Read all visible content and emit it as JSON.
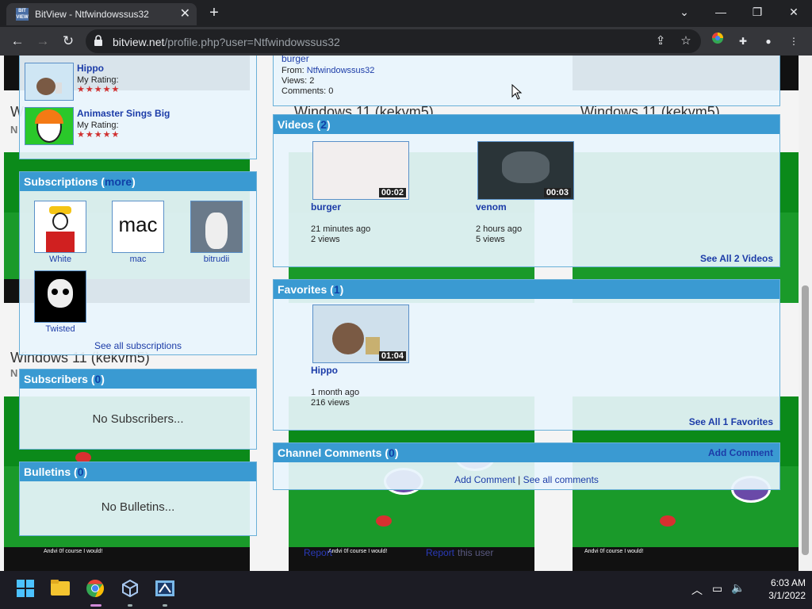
{
  "browser": {
    "tab_title": "BitView - Ntfwindowssus32",
    "favicon_text": "BIT VIEW",
    "tab_close": "✕",
    "new_tab": "+",
    "url_host": "bitview.net",
    "url_path": "/profile.php?user=Ntfwindowssus32"
  },
  "background": {
    "caption": "Windows 11 (kekvm5)",
    "small_text": "N",
    "gibberish": "Andvi 0f course I would!",
    "report": "Report",
    "this_user": "this user"
  },
  "favorites_sidebar": {
    "items": [
      {
        "title": "Hippo",
        "rating_label": "My Rating:",
        "stars": "★★★★★"
      },
      {
        "title": "Animaster Sings Big",
        "rating_label": "My Rating:",
        "stars": "★★★★★"
      }
    ]
  },
  "subscriptions": {
    "title": "Subscriptions",
    "open_paren": " (",
    "more": "more",
    "close_paren": ")",
    "items": [
      {
        "name": "White"
      },
      {
        "name": "mac",
        "thumb_text": "mac"
      },
      {
        "name": "bitrudii"
      },
      {
        "name": "Twisted"
      }
    ],
    "see_all": "See all subscriptions"
  },
  "subscribers": {
    "title": "Subscribers",
    "count": "0",
    "empty": "No Subscribers..."
  },
  "bulletins": {
    "title": "Bulletins",
    "count": "0",
    "empty": "No Bulletins..."
  },
  "comment_top": {
    "video": "burger",
    "from_label": "From: ",
    "from_user": "Ntfwindowssus32",
    "views": "Views: 2",
    "comments": "Comments: 0"
  },
  "videos": {
    "title": "Videos",
    "count": "2",
    "items": [
      {
        "title": "burger",
        "duration": "00:02",
        "age": "21 minutes ago",
        "views": "2 views"
      },
      {
        "title": "venom",
        "duration": "00:03",
        "age": "2 hours ago",
        "views": "5 views"
      }
    ],
    "see_all": "See All 2 Videos"
  },
  "favorites": {
    "title": "Favorites",
    "count": "1",
    "items": [
      {
        "title": "Hippo",
        "duration": "01:04",
        "age": "1 month ago",
        "views": "216 views"
      }
    ],
    "see_all": "See All 1 Favorites"
  },
  "channel_comments": {
    "title": "Channel Comments",
    "count": "0",
    "add_comment_header": "Add Comment",
    "add_comment": "Add Comment",
    "sep": " | ",
    "see_all": "See all comments"
  },
  "taskbar": {
    "time": "6:03 AM",
    "date": "3/1/2022"
  },
  "colors": {
    "panel_header": "#3a9ad2",
    "link": "#1c3ca8",
    "background_green": "#1a9a2a"
  }
}
